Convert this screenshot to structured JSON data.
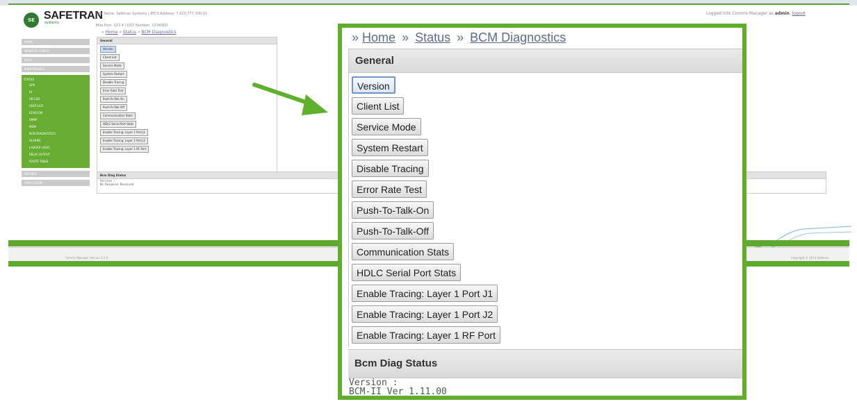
{
  "header": {
    "logo_mark": "SE",
    "logo_text": "SAFETRAN",
    "logo_sub": "systems",
    "site_info": "Site Name: Safetran Systems | ATCS Address: 7.620.777.100.01",
    "mile_info": "Mile Post:  123.4          | DOT Number:  123456D",
    "login_prefix": "Logged into Comms Manager as",
    "login_user": "admin",
    "logout": "logout"
  },
  "breadcrumb": {
    "lead": "»",
    "home": "Home",
    "sep": "»",
    "status": "Status",
    "current": "BCM Diagnostics"
  },
  "sidebar": {
    "top_items": [
      "HOME",
      "MONITOR CONFIG",
      "LOGS",
      "MAINTENANCE"
    ],
    "status_title": "STATUS",
    "status_items": [
      "GPS",
      "IO",
      "UD LED",
      "USER LED",
      "ECHELON",
      "SNMP",
      "MDM",
      "BCM DIAGNOSTICS",
      "ALARMS",
      "LADDER LOGIC",
      "RELAY OUTPUT",
      "ROUTE TABLE"
    ],
    "bottom_items": [
      "REPORTS",
      "APPLICATION"
    ]
  },
  "general": {
    "title": "General",
    "buttons": [
      "Version",
      "Client List",
      "Service Mode",
      "System Restart",
      "Disable Tracing",
      "Error Rate Test",
      "Push-To-Talk-On",
      "Push-To-Talk-Off",
      "Communication Stats",
      "HDLC Serial Port Stats",
      "Enable Tracing: Layer 1 Port J1",
      "Enable Tracing: Layer 1 Port J2",
      "Enable Tracing: Layer 1 RF Port"
    ]
  },
  "bcm_status": {
    "title": "Bcm Diag Status",
    "line1": "Version :",
    "line2_bg": "No Response Received",
    "line2_zoom": "BCM-II Ver 1.11.00"
  },
  "footer": {
    "left": "Comms Manager Version 1.5.0",
    "right": "Copyright © 2014 Safetran"
  },
  "colors": {
    "accent_green": "#61ad2c",
    "link_blue": "#5b6a92"
  }
}
